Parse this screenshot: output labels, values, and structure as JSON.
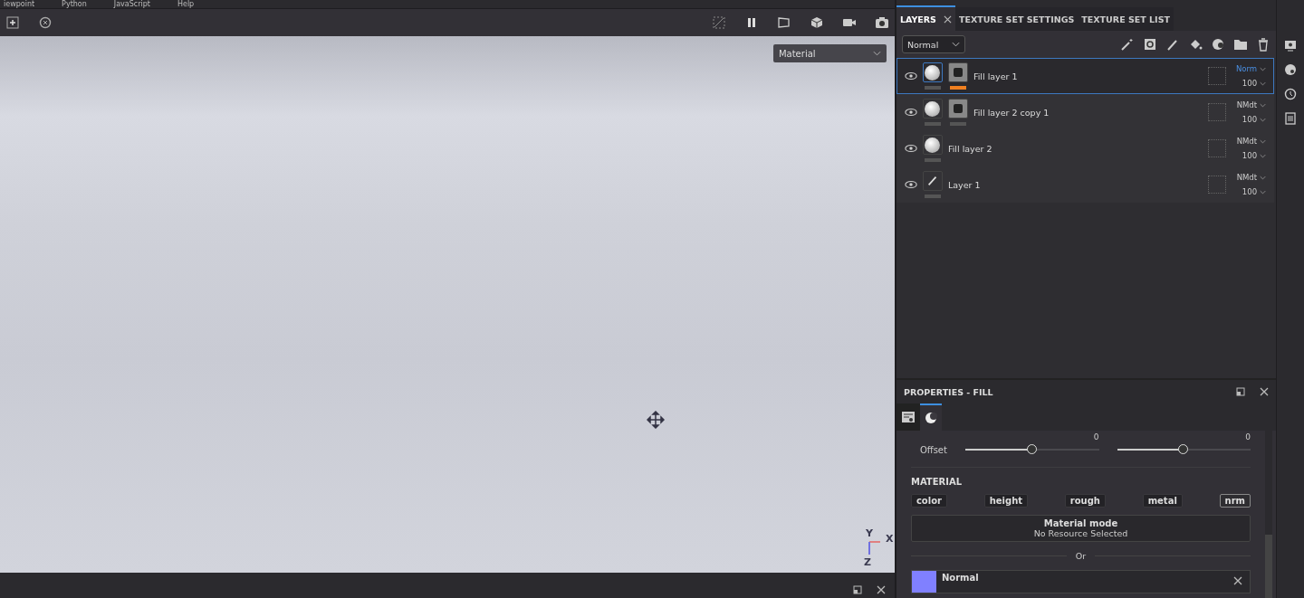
{
  "menu": [
    "iewpoint",
    "Python",
    "JavaScript",
    "Help"
  ],
  "viewport": {
    "channel": "Material",
    "axes": [
      "Y",
      "X",
      "Z"
    ]
  },
  "panel_tabs": [
    {
      "label": "LAYERS",
      "selected": true,
      "closable": true
    },
    {
      "label": "TEXTURE SET SETTINGS",
      "selected": false,
      "closable": false
    },
    {
      "label": "TEXTURE SET LIST",
      "selected": false,
      "closable": false
    }
  ],
  "blend_select": "Normal",
  "layers": [
    {
      "name": "Fill layer 1",
      "kind": "fill",
      "mask": true,
      "selected": true,
      "blend": "Norm",
      "opacity": "100"
    },
    {
      "name": "Fill layer 2 copy 1",
      "kind": "fill",
      "mask": true,
      "selected": false,
      "blend": "NMdt",
      "opacity": "100"
    },
    {
      "name": "Fill layer 2",
      "kind": "fill",
      "mask": false,
      "selected": false,
      "blend": "NMdt",
      "opacity": "100"
    },
    {
      "name": "Layer 1",
      "kind": "paint",
      "mask": false,
      "selected": false,
      "blend": "NMdt",
      "opacity": "100"
    }
  ],
  "properties": {
    "title": "PROPERTIES - FILL",
    "tabs": [
      {
        "selected": false
      },
      {
        "selected": true
      }
    ],
    "offset": {
      "label": "Offset",
      "sliders": [
        {
          "value": "0",
          "level": 0.5
        },
        {
          "value": "0",
          "level": 0.5
        }
      ]
    },
    "material_heading": "MATERIAL",
    "channels": [
      {
        "label": "color",
        "on": false
      },
      {
        "label": "height",
        "on": false
      },
      {
        "label": "rough",
        "on": false
      },
      {
        "label": "metal",
        "on": false
      },
      {
        "label": "nrm",
        "on": true
      }
    ],
    "mode_title": "Material mode",
    "mode_value": "No Resource Selected",
    "or": "Or",
    "resource": {
      "name": "Normal",
      "color": "#8080ff"
    }
  }
}
